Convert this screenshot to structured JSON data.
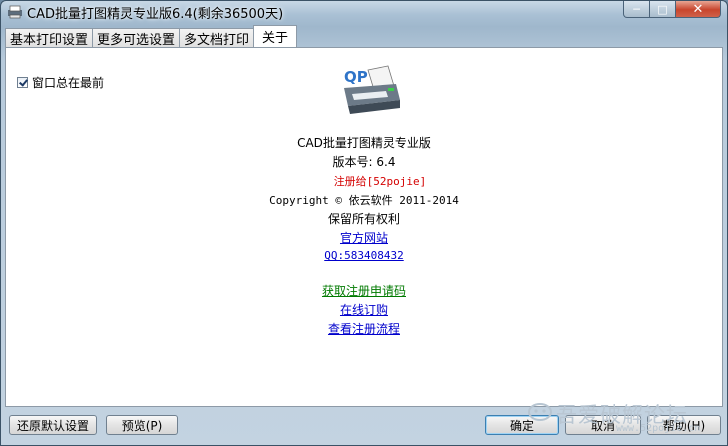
{
  "window": {
    "title": "CAD批量打图精灵专业版6.4(剩余36500天)"
  },
  "controls": {
    "min": "─",
    "max": "□",
    "close": "✕"
  },
  "tabs": [
    {
      "label": "基本打印设置",
      "active": false
    },
    {
      "label": "更多可选设置",
      "active": false
    },
    {
      "label": "多文档打印",
      "active": false
    },
    {
      "label": "关于",
      "active": true
    }
  ],
  "about": {
    "checkbox_label": "窗口总在最前",
    "checkbox_checked": true,
    "logo_text": "QP",
    "product_name": "CAD批量打图精灵专业版",
    "version": "版本号: 6.4",
    "registered_to": "注册给[52pojie]",
    "copyright": "Copyright © 依云软件 2011-2014",
    "rights": "保留所有权利",
    "official_site": "官方网站",
    "qq": "QQ:583408432",
    "get_code": "获取注册申请码",
    "buy_online": "在线订购",
    "view_process": "查看注册流程"
  },
  "buttons": {
    "restore_defaults": "还原默认设置",
    "preview": "预览(P)",
    "ok": "确定",
    "cancel": "取消",
    "help": "帮助(H)"
  },
  "watermark": {
    "text": "吾爱破解论坛",
    "url": "www.52pojie.cn"
  },
  "colors": {
    "red": "#d40000",
    "link": "#0000cc",
    "green": "#007a00"
  }
}
